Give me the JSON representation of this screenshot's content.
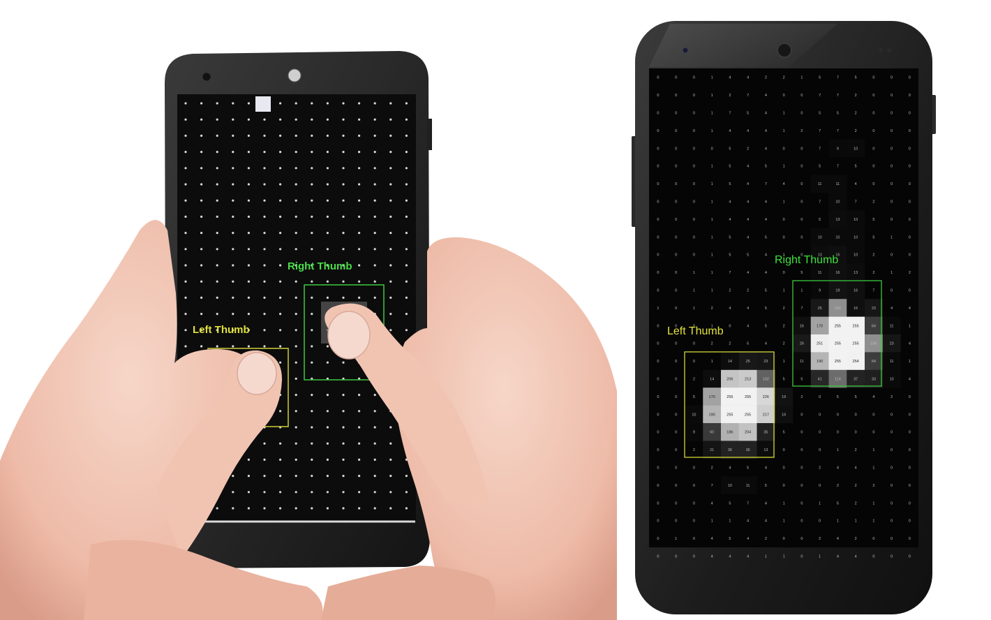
{
  "photo_panel": {
    "right_label": "Right Thumb",
    "left_label": "Left Thumb"
  },
  "device_panel": {
    "right_label": "Right Thumb",
    "left_label": "Left Thumb",
    "grid": [
      [
        0,
        0,
        0,
        1,
        4,
        4,
        2,
        2,
        1,
        5,
        7,
        5,
        0,
        0,
        0
      ],
      [
        0,
        0,
        0,
        1,
        2,
        7,
        4,
        0,
        0,
        7,
        7,
        2,
        0,
        0,
        0
      ],
      [
        0,
        0,
        0,
        1,
        7,
        5,
        4,
        1,
        0,
        5,
        5,
        2,
        0,
        0,
        0
      ],
      [
        0,
        0,
        0,
        1,
        4,
        4,
        4,
        1,
        2,
        7,
        7,
        2,
        0,
        0,
        0
      ],
      [
        0,
        0,
        0,
        0,
        5,
        2,
        4,
        0,
        0,
        7,
        9,
        10,
        0,
        0,
        0
      ],
      [
        0,
        0,
        0,
        1,
        5,
        4,
        5,
        1,
        0,
        5,
        7,
        5,
        0,
        0,
        0
      ],
      [
        0,
        0,
        0,
        1,
        5,
        4,
        7,
        4,
        0,
        11,
        11,
        4,
        0,
        0,
        0
      ],
      [
        0,
        0,
        0,
        1,
        4,
        4,
        4,
        1,
        0,
        7,
        10,
        7,
        2,
        0,
        0
      ],
      [
        0,
        0,
        0,
        1,
        4,
        4,
        4,
        0,
        0,
        5,
        13,
        10,
        5,
        0,
        0
      ],
      [
        0,
        0,
        0,
        1,
        5,
        4,
        5,
        0,
        0,
        10,
        10,
        10,
        5,
        1,
        0
      ],
      [
        0,
        0,
        0,
        1,
        5,
        5,
        4,
        1,
        0,
        13,
        16,
        10,
        2,
        0,
        0
      ],
      [
        0,
        0,
        1,
        1,
        7,
        4,
        4,
        0,
        5,
        11,
        16,
        13,
        2,
        1,
        2
      ],
      [
        0,
        0,
        1,
        1,
        2,
        2,
        5,
        1,
        1,
        9,
        19,
        16,
        7,
        0,
        0
      ],
      [
        1,
        0,
        1,
        2,
        4,
        4,
        5,
        2,
        7,
        25,
        150,
        16,
        23,
        4,
        4
      ],
      [
        0,
        0,
        0,
        1,
        0,
        4,
        5,
        2,
        16,
        170,
        255,
        255,
        64,
        11,
        1
      ],
      [
        0,
        0,
        0,
        2,
        2,
        5,
        4,
        2,
        26,
        251,
        255,
        255,
        150,
        23,
        4
      ],
      [
        0,
        0,
        0,
        1,
        14,
        25,
        23,
        1,
        11,
        190,
        255,
        254,
        64,
        11,
        1
      ],
      [
        0,
        0,
        2,
        14,
        206,
        213,
        102,
        5,
        5,
        41,
        114,
        37,
        33,
        10,
        4
      ],
      [
        0,
        0,
        5,
        170,
        255,
        255,
        226,
        19,
        2,
        0,
        5,
        5,
        4,
        2,
        0
      ],
      [
        0,
        0,
        10,
        190,
        255,
        255,
        217,
        16,
        0,
        0,
        0,
        0,
        0,
        0,
        0
      ],
      [
        0,
        0,
        9,
        60,
        186,
        204,
        35,
        5,
        0,
        0,
        0,
        0,
        0,
        0,
        0
      ],
      [
        0,
        0,
        2,
        21,
        36,
        36,
        13,
        0,
        0,
        0,
        1,
        2,
        1,
        0,
        0
      ],
      [
        0,
        0,
        0,
        2,
        4,
        5,
        4,
        0,
        0,
        2,
        4,
        4,
        1,
        0,
        0
      ],
      [
        0,
        0,
        0,
        7,
        10,
        11,
        5,
        0,
        0,
        0,
        2,
        2,
        2,
        0,
        0
      ],
      [
        0,
        0,
        0,
        4,
        5,
        7,
        4,
        1,
        0,
        1,
        5,
        2,
        1,
        0,
        0
      ],
      [
        0,
        0,
        0,
        1,
        1,
        4,
        4,
        1,
        0,
        0,
        1,
        1,
        1,
        0,
        0
      ],
      [
        0,
        1,
        0,
        4,
        5,
        4,
        2,
        0,
        0,
        2,
        4,
        2,
        0,
        0,
        0
      ],
      [
        0,
        0,
        0,
        4,
        4,
        4,
        1,
        1,
        0,
        1,
        4,
        4,
        0,
        0,
        0
      ]
    ]
  },
  "colors": {
    "right_thumb": "#3ec83e",
    "left_thumb": "#d6d635",
    "screen_bg": "#050505",
    "phone_body": "#1b1b1b"
  }
}
